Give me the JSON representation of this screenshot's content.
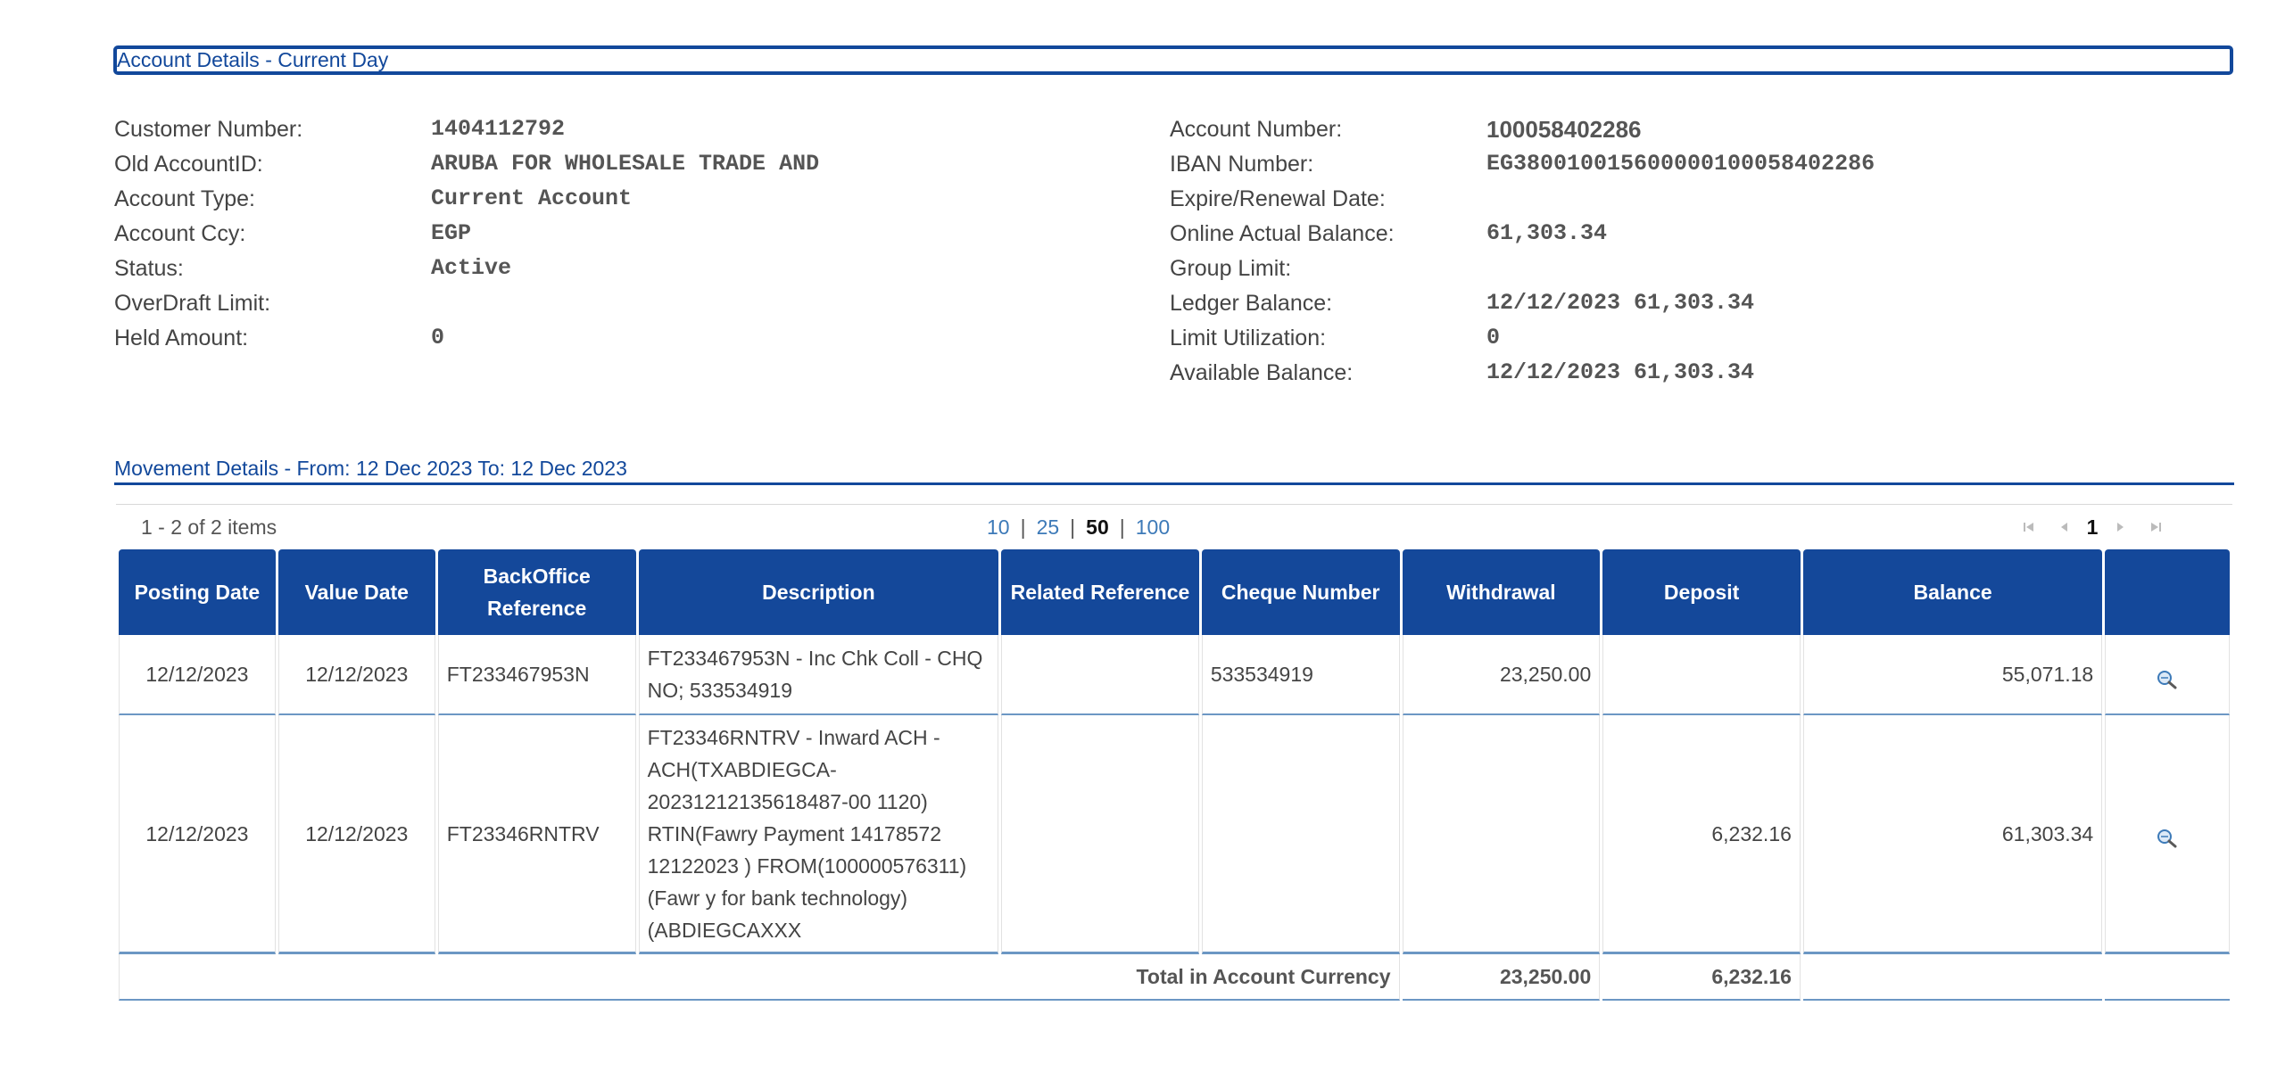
{
  "account_section": {
    "title": "Account Details - Current Day",
    "left": [
      {
        "label": "Customer Number:",
        "value": "1404112792"
      },
      {
        "label": "Old AccountID:",
        "value": "ARUBA FOR WHOLESALE TRADE AND"
      },
      {
        "label": "Account Type:",
        "value": "Current Account"
      },
      {
        "label": "Account Ccy:",
        "value": "EGP"
      },
      {
        "label": "Status:",
        "value": "Active"
      },
      {
        "label": "OverDraft Limit:",
        "value": ""
      },
      {
        "label": "Held Amount:",
        "value": "0"
      }
    ],
    "right": [
      {
        "label": "Account Number:",
        "value": "100058402286"
      },
      {
        "label": "IBAN Number:",
        "value": "EG380010015600000100058402286"
      },
      {
        "label": "Expire/Renewal Date:",
        "value": ""
      },
      {
        "label": "Online Actual Balance:",
        "value": "61,303.34"
      },
      {
        "label": "Group Limit:",
        "value": ""
      },
      {
        "label": "Ledger Balance:",
        "value": "12/12/2023 61,303.34"
      },
      {
        "label": "Limit Utilization:",
        "value": "0"
      },
      {
        "label": "Available Balance:",
        "value": "12/12/2023 61,303.34"
      }
    ]
  },
  "movement_section": {
    "title": "Movement Details - From: 12 Dec 2023 To: 12 Dec 2023",
    "pager": {
      "info": "1 - 2 of 2 items",
      "sizes": [
        "10",
        "25",
        "50",
        "100"
      ],
      "active_size": "50",
      "current_page": "1"
    },
    "columns": [
      "Posting Date",
      "Value Date",
      "BackOffice Reference",
      "Description",
      "Related Reference",
      "Cheque Number",
      "Withdrawal",
      "Deposit",
      "Balance",
      ""
    ],
    "rows": [
      {
        "posting_date": "12/12/2023",
        "value_date": "12/12/2023",
        "backoffice_ref": "FT233467953N",
        "description": "FT233467953N - Inc Chk Coll - CHQ NO; 533534919",
        "related_ref": "",
        "cheque_number": "533534919",
        "withdrawal": "23,250.00",
        "deposit": "",
        "balance": "55,071.18"
      },
      {
        "posting_date": "12/12/2023",
        "value_date": "12/12/2023",
        "backoffice_ref": "FT23346RNTRV",
        "description": "FT23346RNTRV - Inward ACH - ACH(TXABDIEGCA-20231212135618487-00 1120) RTIN(Fawry Payment 14178572 12122023 ) FROM(100000576311) (Fawr y for bank technology) (ABDIEGCAXXX",
        "related_ref": "",
        "cheque_number": "",
        "withdrawal": "",
        "deposit": "6,232.16",
        "balance": "61,303.34"
      }
    ],
    "totals": {
      "label": "Total in Account Currency",
      "withdrawal": "23,250.00",
      "deposit": "6,232.16"
    }
  },
  "colors": {
    "brand_blue": "#14489a",
    "link_blue": "#3d7ab8",
    "row_divider": "#6c97c4"
  },
  "icons": {
    "row_action": "magnifier-zoom-icon",
    "pager_first": "first-page-icon",
    "pager_prev": "prev-page-icon",
    "pager_next": "next-page-icon",
    "pager_last": "last-page-icon"
  }
}
